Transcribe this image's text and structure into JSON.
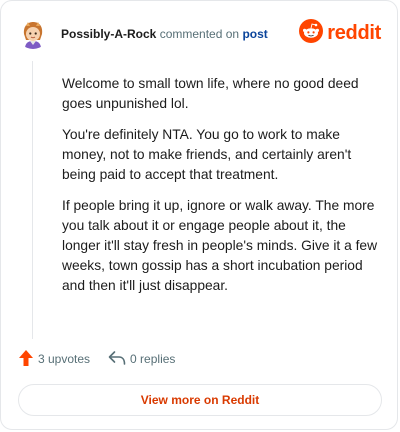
{
  "header": {
    "username": "Possibly-A-Rock",
    "commented_text": "commented on",
    "post_link": "post",
    "logo_text": "reddit"
  },
  "comment": {
    "paragraphs": [
      "Welcome to small town life, where no good deed goes unpunished lol.",
      "You're definitely NTA. You go to work to make money, not to make friends, and certainly aren't being paid to accept that treatment.",
      "If people bring it up, ignore or walk away. The more you talk about it or engage people about it, the longer it'll stay fresh in people's minds. Give it a few weeks, town gossip has a short incubation period and then it'll just disappear."
    ]
  },
  "actions": {
    "upvotes_label": "3 upvotes",
    "replies_label": "0 replies"
  },
  "footer": {
    "view_more_label": "View more on Reddit"
  },
  "colors": {
    "brand": "#ff4500",
    "upvote": "#ff4500",
    "link": "#0a449b",
    "view_more": "#d93a00",
    "muted": "#576f76"
  },
  "icons": {
    "avatar": "avatar-icon",
    "logo": "reddit-snoo-icon",
    "upvote": "arrow-up-icon",
    "reply": "reply-arrow-icon"
  }
}
